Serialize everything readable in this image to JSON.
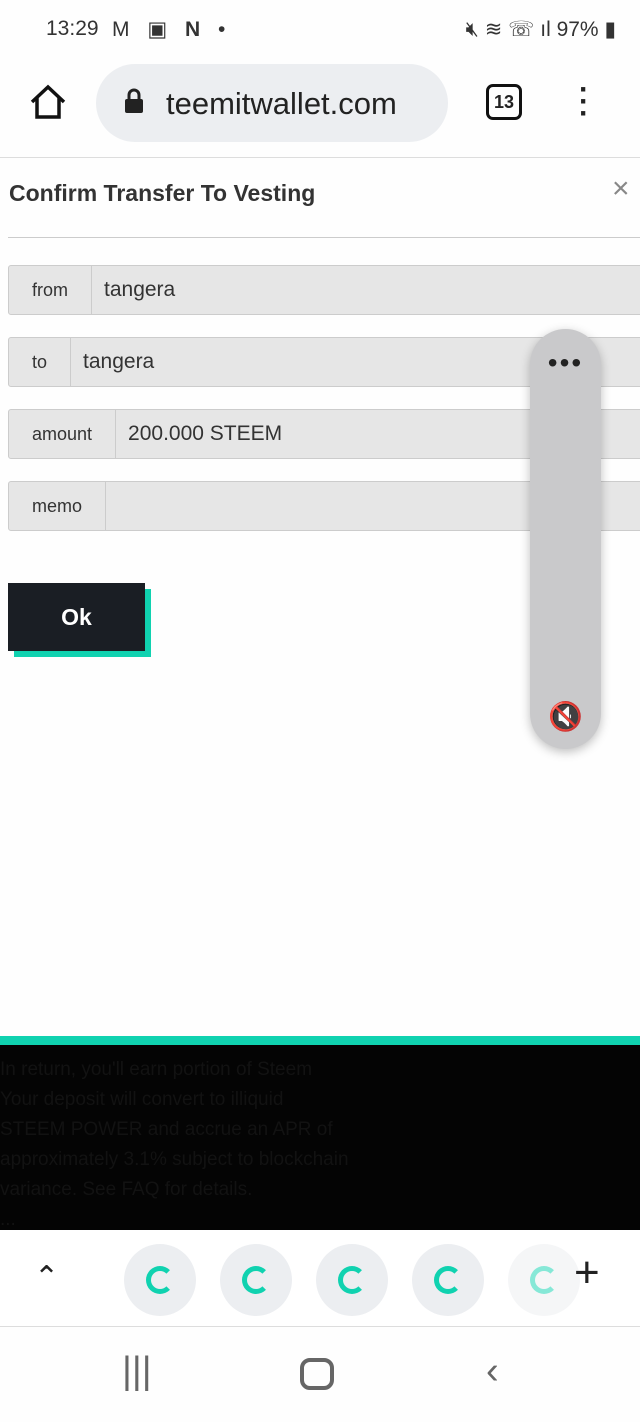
{
  "status": {
    "time": "13:29",
    "left_icons": [
      "gmail-icon",
      "gallery-icon",
      "n-app-icon",
      "dot-icon"
    ],
    "right_icons": [
      "mute-icon",
      "wifi-icon",
      "wifi-call-icon",
      "signal-icon"
    ],
    "battery": "97%"
  },
  "browser": {
    "url": "teemitwallet.com",
    "tab_count": "13"
  },
  "dialog": {
    "title": "Confirm Transfer To Vesting",
    "close": "×",
    "fields": [
      {
        "label": "from",
        "value": "tangera"
      },
      {
        "label": "to",
        "value": "tangera"
      },
      {
        "label": "amount",
        "value": "200.000 STEEM"
      },
      {
        "label": "memo",
        "value": ""
      }
    ],
    "ok_label": "Ok"
  },
  "floating": {
    "more": "•••",
    "mute": "🔇"
  },
  "footer_text": [
    "In return, you'll earn portion of Steem",
    "Your deposit will convert to illiquid",
    "STEEM POWER and accrue an APR of",
    "approximately 3.1% subject to blockchain",
    "variance. See FAQ for details.",
    "..."
  ],
  "bottom": {
    "up": "⌃",
    "plus": "+"
  },
  "accent": "#10d2b0"
}
